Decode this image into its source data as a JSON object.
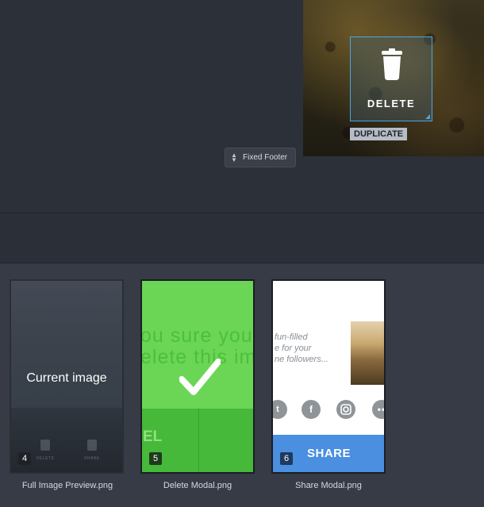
{
  "canvas": {
    "delete_label": "DELETE",
    "duplicate_label": "DUPLICATE",
    "fixed_footer_label": "Fixed Footer"
  },
  "screens": [
    {
      "filename": "Full Image Preview.png",
      "number": "4",
      "overlay_label": "Current image",
      "mini_labels": [
        "DELETE",
        "SHARE"
      ]
    },
    {
      "filename": "Delete Modal.png",
      "number": "5",
      "text_lines": [
        "ou sure you",
        "elete this ima"
      ],
      "fragment": "EL"
    },
    {
      "filename": "Share Modal.png",
      "number": "6",
      "copy_lines": [
        "fun-filled",
        "e for your",
        "ne followers..."
      ],
      "share_label": "SHARE",
      "social_icons": [
        "twitter-icon",
        "facebook-icon",
        "instagram-icon",
        "more-icon"
      ]
    }
  ],
  "colors": {
    "selection": "#4aa6e0",
    "green": "#6bd655",
    "blue": "#4a8fe0"
  }
}
